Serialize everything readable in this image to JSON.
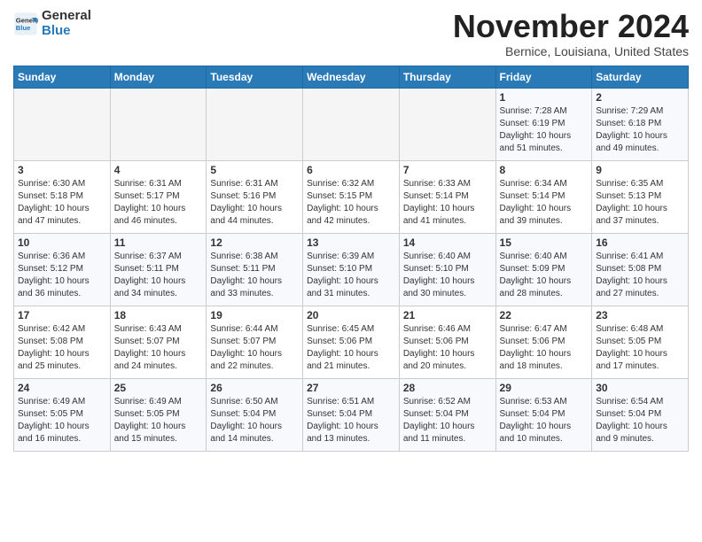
{
  "header": {
    "logo_general": "General",
    "logo_blue": "Blue",
    "month_title": "November 2024",
    "subtitle": "Bernice, Louisiana, United States"
  },
  "days_of_week": [
    "Sunday",
    "Monday",
    "Tuesday",
    "Wednesday",
    "Thursday",
    "Friday",
    "Saturday"
  ],
  "weeks": [
    [
      {
        "day": "",
        "info": ""
      },
      {
        "day": "",
        "info": ""
      },
      {
        "day": "",
        "info": ""
      },
      {
        "day": "",
        "info": ""
      },
      {
        "day": "",
        "info": ""
      },
      {
        "day": "1",
        "info": "Sunrise: 7:28 AM\nSunset: 6:19 PM\nDaylight: 10 hours and 51 minutes."
      },
      {
        "day": "2",
        "info": "Sunrise: 7:29 AM\nSunset: 6:18 PM\nDaylight: 10 hours and 49 minutes."
      }
    ],
    [
      {
        "day": "3",
        "info": "Sunrise: 6:30 AM\nSunset: 5:18 PM\nDaylight: 10 hours and 47 minutes."
      },
      {
        "day": "4",
        "info": "Sunrise: 6:31 AM\nSunset: 5:17 PM\nDaylight: 10 hours and 46 minutes."
      },
      {
        "day": "5",
        "info": "Sunrise: 6:31 AM\nSunset: 5:16 PM\nDaylight: 10 hours and 44 minutes."
      },
      {
        "day": "6",
        "info": "Sunrise: 6:32 AM\nSunset: 5:15 PM\nDaylight: 10 hours and 42 minutes."
      },
      {
        "day": "7",
        "info": "Sunrise: 6:33 AM\nSunset: 5:14 PM\nDaylight: 10 hours and 41 minutes."
      },
      {
        "day": "8",
        "info": "Sunrise: 6:34 AM\nSunset: 5:14 PM\nDaylight: 10 hours and 39 minutes."
      },
      {
        "day": "9",
        "info": "Sunrise: 6:35 AM\nSunset: 5:13 PM\nDaylight: 10 hours and 37 minutes."
      }
    ],
    [
      {
        "day": "10",
        "info": "Sunrise: 6:36 AM\nSunset: 5:12 PM\nDaylight: 10 hours and 36 minutes."
      },
      {
        "day": "11",
        "info": "Sunrise: 6:37 AM\nSunset: 5:11 PM\nDaylight: 10 hours and 34 minutes."
      },
      {
        "day": "12",
        "info": "Sunrise: 6:38 AM\nSunset: 5:11 PM\nDaylight: 10 hours and 33 minutes."
      },
      {
        "day": "13",
        "info": "Sunrise: 6:39 AM\nSunset: 5:10 PM\nDaylight: 10 hours and 31 minutes."
      },
      {
        "day": "14",
        "info": "Sunrise: 6:40 AM\nSunset: 5:10 PM\nDaylight: 10 hours and 30 minutes."
      },
      {
        "day": "15",
        "info": "Sunrise: 6:40 AM\nSunset: 5:09 PM\nDaylight: 10 hours and 28 minutes."
      },
      {
        "day": "16",
        "info": "Sunrise: 6:41 AM\nSunset: 5:08 PM\nDaylight: 10 hours and 27 minutes."
      }
    ],
    [
      {
        "day": "17",
        "info": "Sunrise: 6:42 AM\nSunset: 5:08 PM\nDaylight: 10 hours and 25 minutes."
      },
      {
        "day": "18",
        "info": "Sunrise: 6:43 AM\nSunset: 5:07 PM\nDaylight: 10 hours and 24 minutes."
      },
      {
        "day": "19",
        "info": "Sunrise: 6:44 AM\nSunset: 5:07 PM\nDaylight: 10 hours and 22 minutes."
      },
      {
        "day": "20",
        "info": "Sunrise: 6:45 AM\nSunset: 5:06 PM\nDaylight: 10 hours and 21 minutes."
      },
      {
        "day": "21",
        "info": "Sunrise: 6:46 AM\nSunset: 5:06 PM\nDaylight: 10 hours and 20 minutes."
      },
      {
        "day": "22",
        "info": "Sunrise: 6:47 AM\nSunset: 5:06 PM\nDaylight: 10 hours and 18 minutes."
      },
      {
        "day": "23",
        "info": "Sunrise: 6:48 AM\nSunset: 5:05 PM\nDaylight: 10 hours and 17 minutes."
      }
    ],
    [
      {
        "day": "24",
        "info": "Sunrise: 6:49 AM\nSunset: 5:05 PM\nDaylight: 10 hours and 16 minutes."
      },
      {
        "day": "25",
        "info": "Sunrise: 6:49 AM\nSunset: 5:05 PM\nDaylight: 10 hours and 15 minutes."
      },
      {
        "day": "26",
        "info": "Sunrise: 6:50 AM\nSunset: 5:04 PM\nDaylight: 10 hours and 14 minutes."
      },
      {
        "day": "27",
        "info": "Sunrise: 6:51 AM\nSunset: 5:04 PM\nDaylight: 10 hours and 13 minutes."
      },
      {
        "day": "28",
        "info": "Sunrise: 6:52 AM\nSunset: 5:04 PM\nDaylight: 10 hours and 11 minutes."
      },
      {
        "day": "29",
        "info": "Sunrise: 6:53 AM\nSunset: 5:04 PM\nDaylight: 10 hours and 10 minutes."
      },
      {
        "day": "30",
        "info": "Sunrise: 6:54 AM\nSunset: 5:04 PM\nDaylight: 10 hours and 9 minutes."
      }
    ]
  ]
}
